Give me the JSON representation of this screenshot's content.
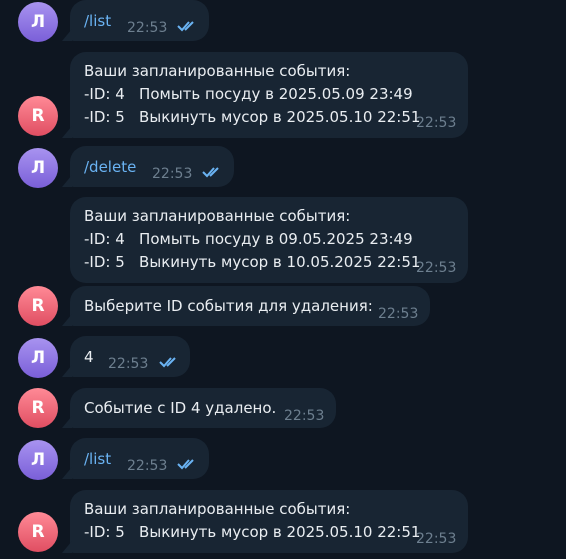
{
  "avatars": {
    "user_initial": "Л",
    "bot_initial": "R"
  },
  "messages": [
    {
      "text": "/list",
      "time": "22:53"
    },
    {
      "lines": [
        "Ваши запланированные события:",
        "-ID: 4   Помыть посуду в 2025.05.09 23:49",
        "-ID: 5   Выкинуть мусор в 2025.05.10 22:51"
      ],
      "time": "22:53"
    },
    {
      "text": "/delete",
      "time": "22:53"
    },
    {
      "lines": [
        "Ваши запланированные события:",
        "-ID: 4   Помыть посуду в 09.05.2025 23:49",
        "-ID: 5   Выкинуть мусор в 10.05.2025 22:51"
      ],
      "time": "22:53"
    },
    {
      "text": "Выберите ID события для удаления:",
      "time": "22:53"
    },
    {
      "text": "4",
      "time": "22:53"
    },
    {
      "text": "Событие с ID 4 удалено.",
      "time": "22:53"
    },
    {
      "text": "/list",
      "time": "22:53"
    },
    {
      "lines": [
        "Ваши запланированные события:",
        "-ID: 5   Выкинуть мусор в 2025.05.10 22:51"
      ],
      "time": "22:53"
    }
  ],
  "colors": {
    "background": "#0e1621",
    "bubble": "#182533",
    "link": "#6ab3f3",
    "time": "#6d7f8f",
    "check": "#6ab3f3"
  },
  "icons": {
    "read_receipt": "double-check-icon"
  }
}
